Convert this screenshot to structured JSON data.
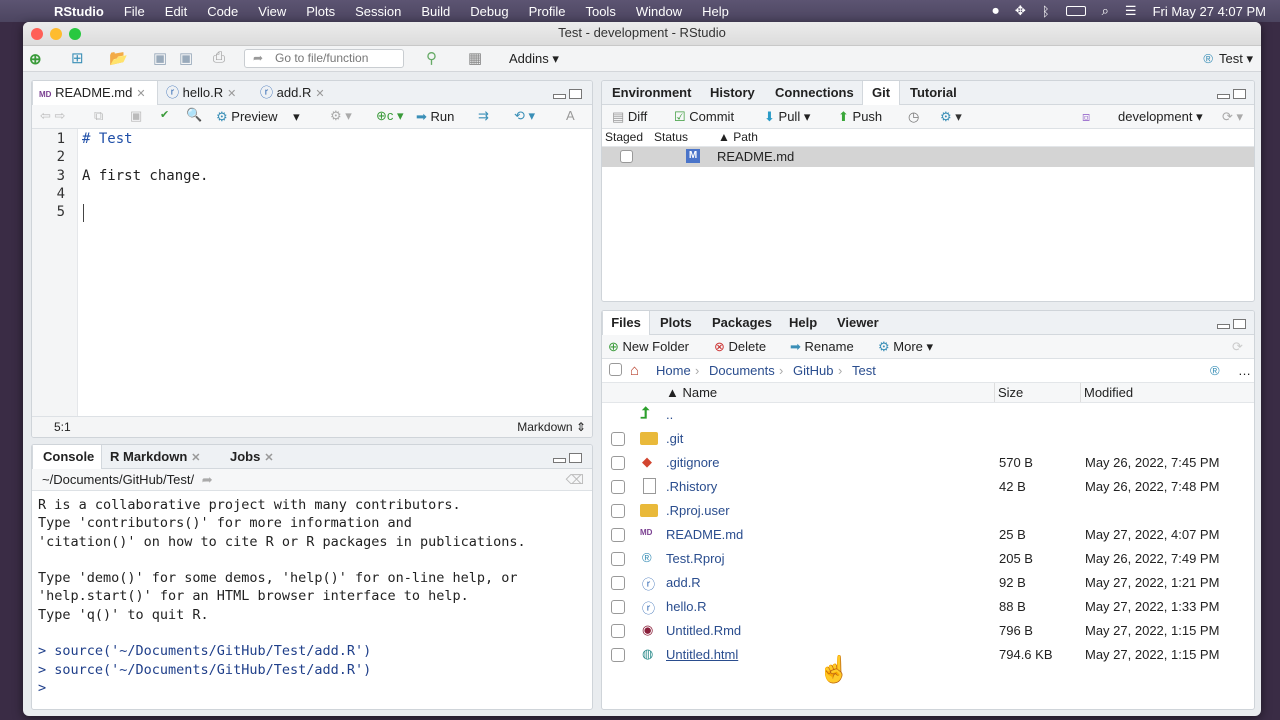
{
  "mac_menu": {
    "app": "RStudio",
    "items": [
      "File",
      "Edit",
      "Code",
      "View",
      "Plots",
      "Session",
      "Build",
      "Debug",
      "Profile",
      "Tools",
      "Window",
      "Help"
    ],
    "clock": "Fri May 27  4:07 PM"
  },
  "window": {
    "title": "Test - development - RStudio"
  },
  "toolbar": {
    "goto_placeholder": "Go to file/function",
    "addins": "Addins",
    "project": "Test"
  },
  "editor": {
    "tabs": [
      "README.md",
      "hello.R",
      "add.R"
    ],
    "preview": "Preview",
    "run": "Run",
    "lines": [
      "# Test",
      "",
      "A first change.",
      "",
      ""
    ],
    "line_numbers": [
      "1",
      "2",
      "3",
      "4",
      "5"
    ],
    "cursor_pos": "5:1",
    "mode": "Markdown"
  },
  "console": {
    "tabs": [
      "Console",
      "R Markdown",
      "Jobs"
    ],
    "path": "~/Documents/GitHub/Test/",
    "lines": [
      "R is a collaborative project with many contributors.",
      "Type 'contributors()' for more information and",
      "'citation()' on how to cite R or R packages in publications.",
      "",
      "Type 'demo()' for some demos, 'help()' for on-line help, or",
      "'help.start()' for an HTML browser interface to help.",
      "Type 'q()' to quit R.",
      "",
      "> source('~/Documents/GitHub/Test/add.R')",
      "> source('~/Documents/GitHub/Test/add.R')",
      "> "
    ]
  },
  "env": {
    "tabs": [
      "Environment",
      "History",
      "Connections",
      "Git",
      "Tutorial"
    ],
    "diff": "Diff",
    "commit": "Commit",
    "pull": "Pull",
    "push": "Push",
    "branch": "development",
    "cols": {
      "staged": "Staged",
      "status": "Status",
      "path": "Path"
    },
    "file": {
      "status": "M",
      "path": "README.md"
    }
  },
  "files": {
    "tabs": [
      "Files",
      "Plots",
      "Packages",
      "Help",
      "Viewer"
    ],
    "new_folder": "New Folder",
    "delete": "Delete",
    "rename": "Rename",
    "more": "More",
    "crumbs": [
      "Home",
      "Documents",
      "GitHub",
      "Test"
    ],
    "cols": {
      "name": "Name",
      "size": "Size",
      "modified": "Modified"
    },
    "rows": [
      {
        "name": "..",
        "size": "",
        "modified": "",
        "icon": "up-arrow"
      },
      {
        "name": ".git",
        "size": "",
        "modified": "",
        "icon": "folder"
      },
      {
        "name": ".gitignore",
        "size": "570 B",
        "modified": "May 26, 2022, 7:45 PM",
        "icon": "git-file"
      },
      {
        "name": ".Rhistory",
        "size": "42 B",
        "modified": "May 26, 2022, 7:48 PM",
        "icon": "file"
      },
      {
        "name": ".Rproj.user",
        "size": "",
        "modified": "",
        "icon": "folder"
      },
      {
        "name": "README.md",
        "size": "25 B",
        "modified": "May 27, 2022, 4:07 PM",
        "icon": "md-file"
      },
      {
        "name": "Test.Rproj",
        "size": "205 B",
        "modified": "May 26, 2022, 7:49 PM",
        "icon": "rproj-file"
      },
      {
        "name": "add.R",
        "size": "92 B",
        "modified": "May 27, 2022, 1:21 PM",
        "icon": "r-file"
      },
      {
        "name": "hello.R",
        "size": "88 B",
        "modified": "May 27, 2022, 1:33 PM",
        "icon": "r-file"
      },
      {
        "name": "Untitled.Rmd",
        "size": "796 B",
        "modified": "May 27, 2022, 1:15 PM",
        "icon": "rmd-file"
      },
      {
        "name": "Untitled.html",
        "size": "794.6 KB",
        "modified": "May 27, 2022, 1:15 PM",
        "icon": "html-file"
      }
    ]
  }
}
